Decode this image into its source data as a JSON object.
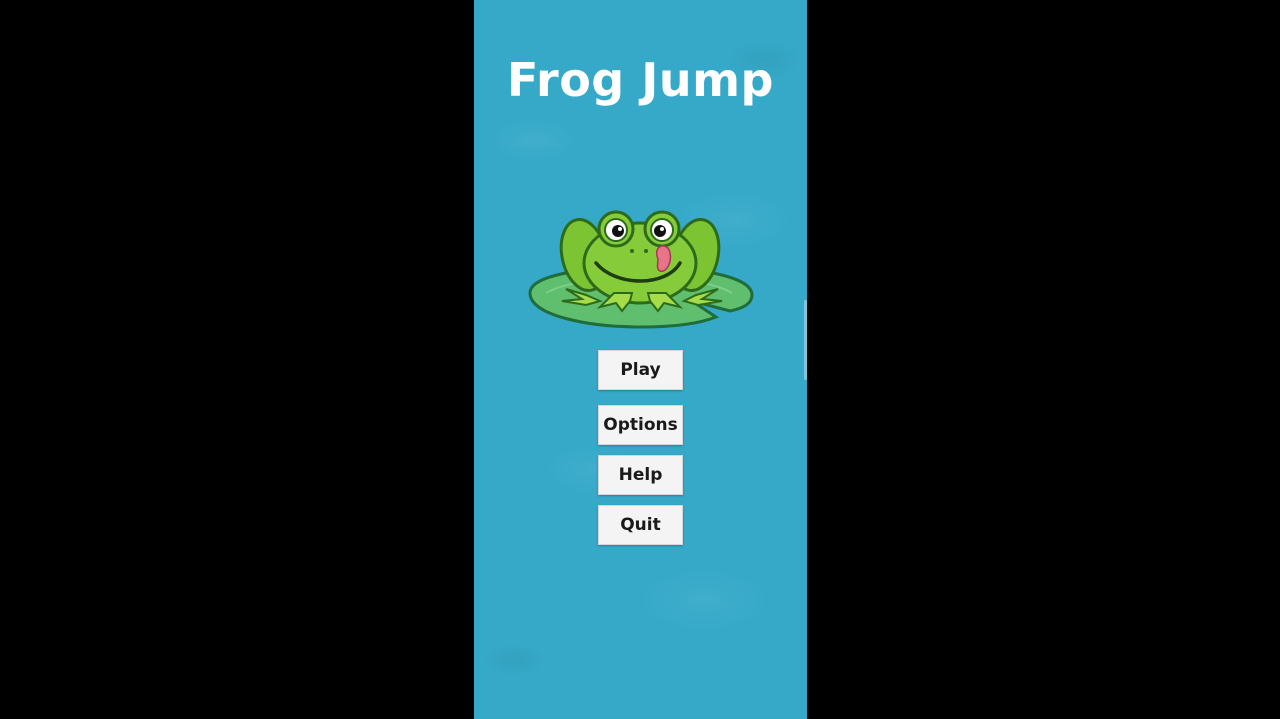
{
  "game": {
    "title": "Frog Jump"
  },
  "menu": {
    "items": [
      {
        "label": "Play"
      },
      {
        "label": "Options"
      },
      {
        "label": "Help"
      },
      {
        "label": "Quit"
      }
    ]
  },
  "colors": {
    "background": "#36a9c9",
    "frog": "#7cc432",
    "lily_pad": "#5fbf6e",
    "button": "#f4f4f4"
  },
  "icons": {
    "hero": "frog-on-lily-pad-icon"
  }
}
